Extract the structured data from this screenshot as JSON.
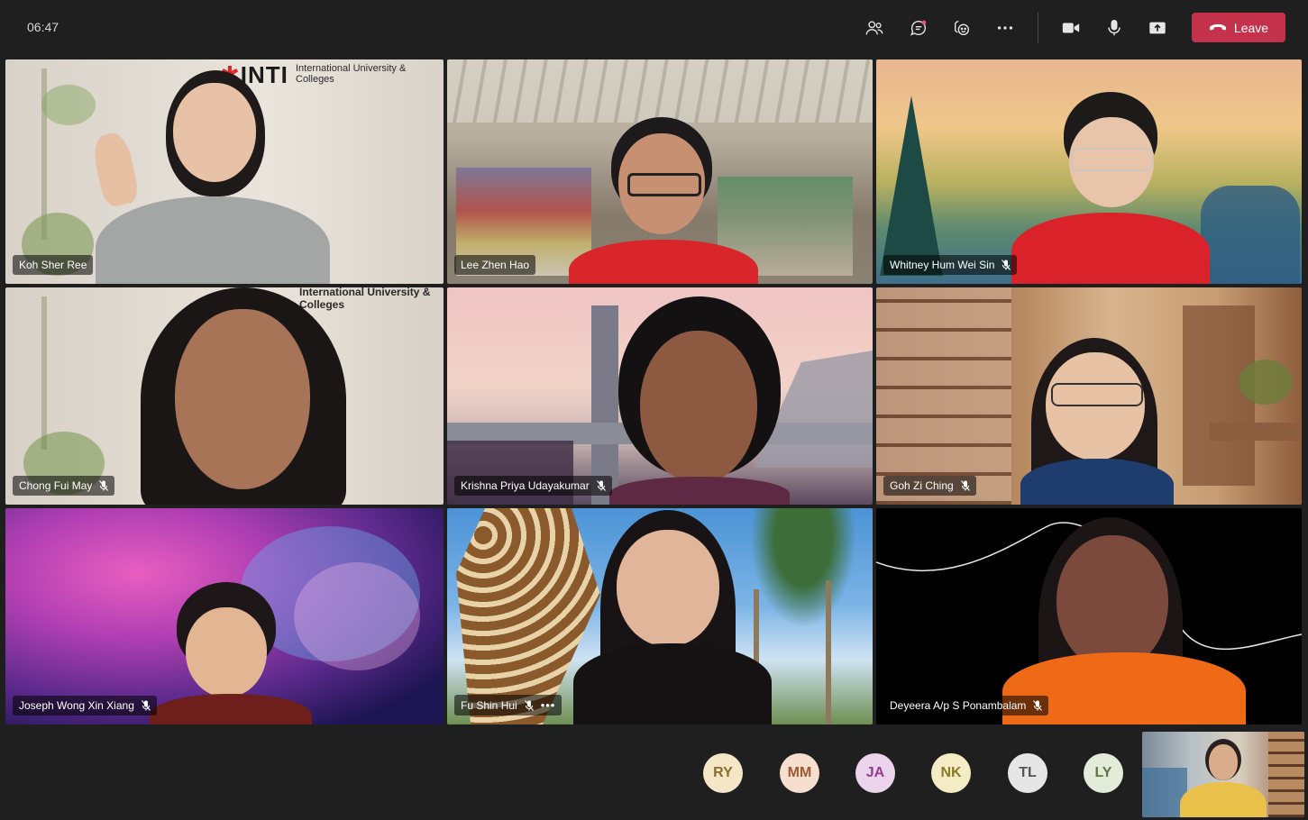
{
  "meeting": {
    "time": "06:47",
    "leave_label": "Leave"
  },
  "toolbar": {
    "icons": [
      "people-icon",
      "chat-icon",
      "reactions-icon",
      "more-options-icon",
      "camera-icon",
      "microphone-icon",
      "share-screen-icon"
    ]
  },
  "participants": [
    {
      "name": "Koh Sher Ree",
      "muted": false,
      "background": "INTI International University & Colleges office wall",
      "brand": "INTI",
      "brand_sub": "International University & Colleges"
    },
    {
      "name": "Lee Zhen Hao",
      "muted": false,
      "background": "shopping mall"
    },
    {
      "name": "Whitney Hum Wei Sin",
      "muted": true,
      "background": "illustrated landscape"
    },
    {
      "name": "Chong Fui May",
      "muted": true,
      "background": "INTI office wall",
      "brand_sub": "International University & Colleges"
    },
    {
      "name": "Krishna Priya Udayakumar",
      "muted": true,
      "background": "bridge at sunset"
    },
    {
      "name": "Goh Zi Ching",
      "muted": true,
      "background": "library bookshelves"
    },
    {
      "name": "Joseph Wong Xin Xiang",
      "muted": true,
      "background": "galaxy nebula"
    },
    {
      "name": "Fu Shin Hui",
      "muted": true,
      "more": "•••",
      "background": "giraffe and palm trees"
    },
    {
      "name": "Deyeera A/p S Ponambalam",
      "muted": true,
      "background": "black with white line"
    }
  ],
  "roster": [
    {
      "initials": "RY",
      "color": "#f4e7c8",
      "text_color": "#8a6d2f"
    },
    {
      "initials": "MM",
      "color": "#f7dfcf",
      "text_color": "#9a5a34"
    },
    {
      "initials": "JA",
      "color": "#ecd3ec",
      "text_color": "#8e3f8e"
    },
    {
      "initials": "NK",
      "color": "#f4ecc5",
      "text_color": "#8a7a25"
    },
    {
      "initials": "TL",
      "color": "#e6e6e6",
      "text_color": "#555555"
    },
    {
      "initials": "LY",
      "color": "#e3ecd8",
      "text_color": "#5c7744"
    }
  ],
  "colors": {
    "leave": "#c4314b",
    "background": "#1f1f1f"
  }
}
